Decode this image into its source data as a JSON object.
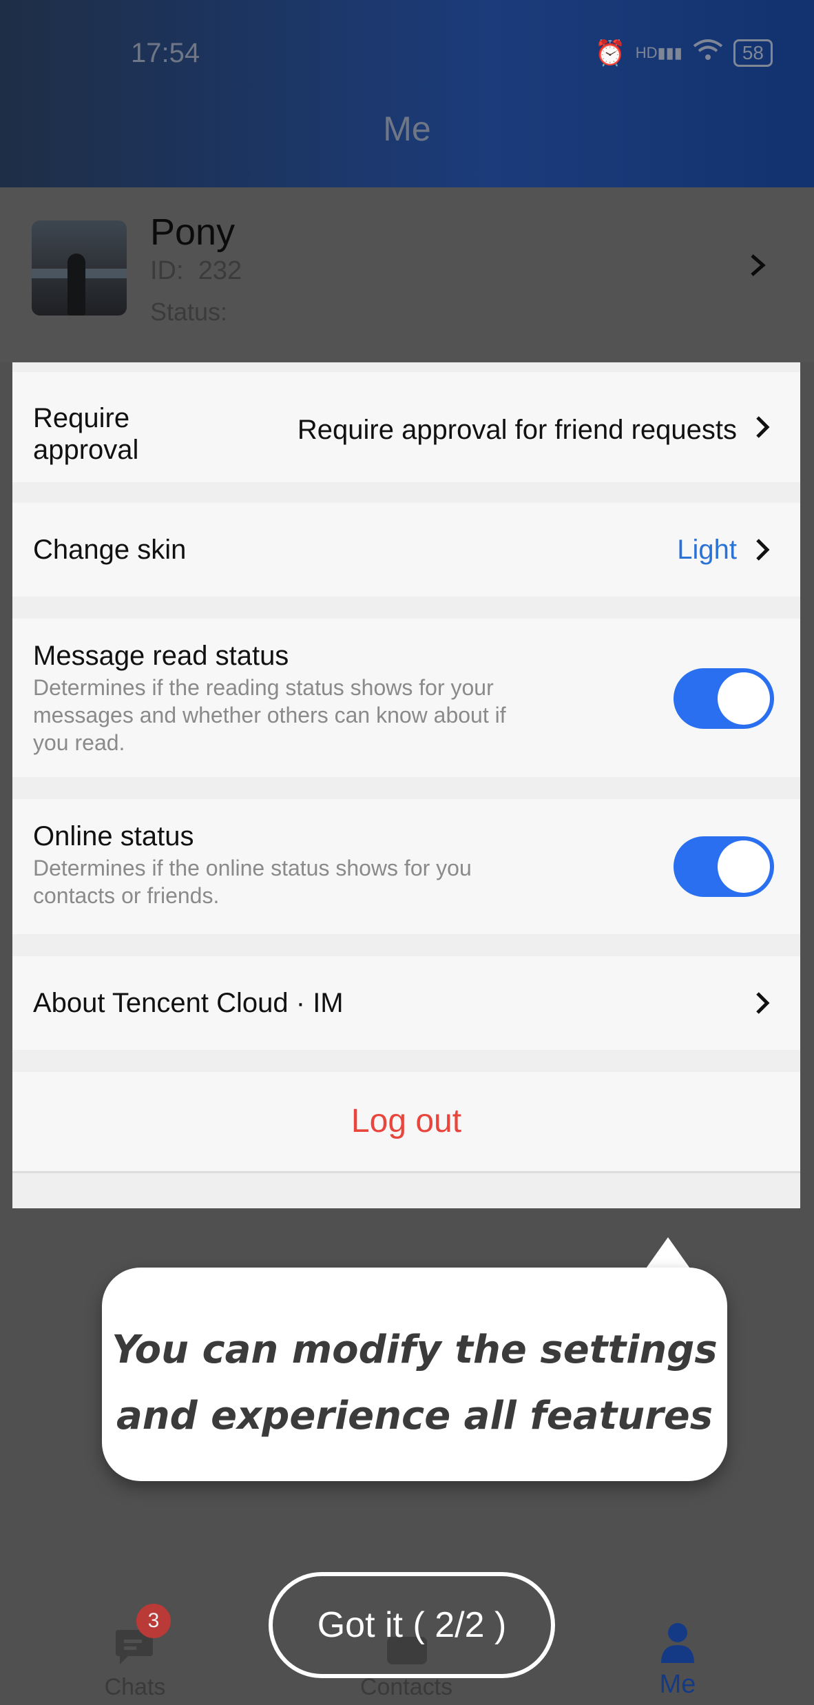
{
  "status_bar": {
    "time": "17:54",
    "network": "HD",
    "battery": "58"
  },
  "header": {
    "title": "Me"
  },
  "profile": {
    "name": "Pony",
    "id_label": "ID:",
    "id_value": "232",
    "status_label": "Status:"
  },
  "settings": {
    "require_approval": {
      "label_line1": "Require",
      "label_line2": "approval",
      "value": "Require approval for friend requests"
    },
    "change_skin": {
      "label": "Change skin",
      "value": "Light"
    },
    "message_read_status": {
      "label": "Message read status",
      "desc_line1": "Determines if the reading status shows for your",
      "desc_line2": "messages and whether others can know about if",
      "desc_line3": "you read.",
      "enabled": true
    },
    "online_status": {
      "label": "Online status",
      "desc_line1": "Determines if the online status shows for you",
      "desc_line2": "contacts or friends.",
      "enabled": true
    },
    "about": {
      "label": "About Tencent Cloud · IM"
    },
    "logout": {
      "label": "Log out"
    }
  },
  "tooltip": {
    "line1": "You can modify the settings",
    "line2": "and experience all features"
  },
  "guide_button": {
    "label": "Got it ( 2/2 )"
  },
  "bottom_nav": {
    "chats": {
      "label": "Chats",
      "badge": "3"
    },
    "contacts": {
      "label": "Contacts"
    },
    "me": {
      "label": "Me"
    }
  },
  "colors": {
    "accent_blue": "#2a6ff0",
    "logout_red": "#e8453c",
    "skin_value_blue": "#2a72d6",
    "badge_red": "#b93a36"
  }
}
